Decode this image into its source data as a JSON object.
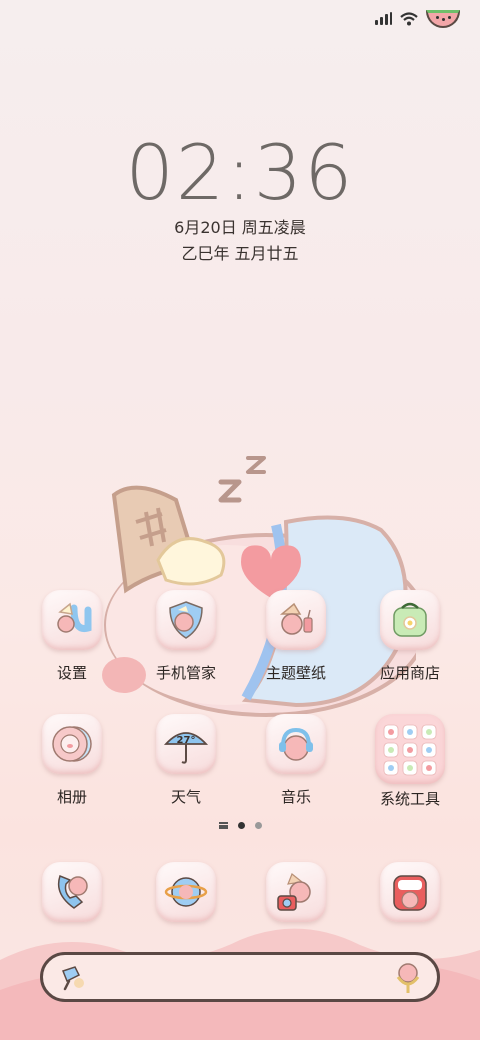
{
  "status_bar": {
    "signal_icon": "signal-bars-icon",
    "wifi_icon": "wifi-icon",
    "battery_icon": "watermelon-battery-icon"
  },
  "lockclock": {
    "time": "02:36",
    "date": "6月20日 周五凌晨",
    "lunar": "乙巳年 五月廿五"
  },
  "apps": [
    {
      "label": "设置",
      "icon": "settings-icon"
    },
    {
      "label": "手机管家",
      "icon": "phone-manager-icon"
    },
    {
      "label": "主题壁纸",
      "icon": "themes-icon"
    },
    {
      "label": "应用商店",
      "icon": "app-store-icon"
    },
    {
      "label": "相册",
      "icon": "gallery-icon"
    },
    {
      "label": "天气",
      "icon": "weather-icon",
      "badge": "27°"
    },
    {
      "label": "音乐",
      "icon": "music-icon"
    },
    {
      "label": "系统工具",
      "icon": "system-tools-folder-icon"
    }
  ],
  "page_indicator": {
    "pages": 2,
    "current": 1
  },
  "dock": [
    {
      "icon": "phone-icon"
    },
    {
      "icon": "browser-icon"
    },
    {
      "icon": "camera-icon"
    },
    {
      "icon": "messages-icon"
    }
  ],
  "search_bar": {
    "left_icon": "search-brush-icon",
    "right_icon": "voice-assistant-icon"
  },
  "colors": {
    "tile_top": "#fffafa",
    "tile_bottom": "#f7dcdc",
    "text": "#2c2623",
    "clock": "#6e6966"
  }
}
